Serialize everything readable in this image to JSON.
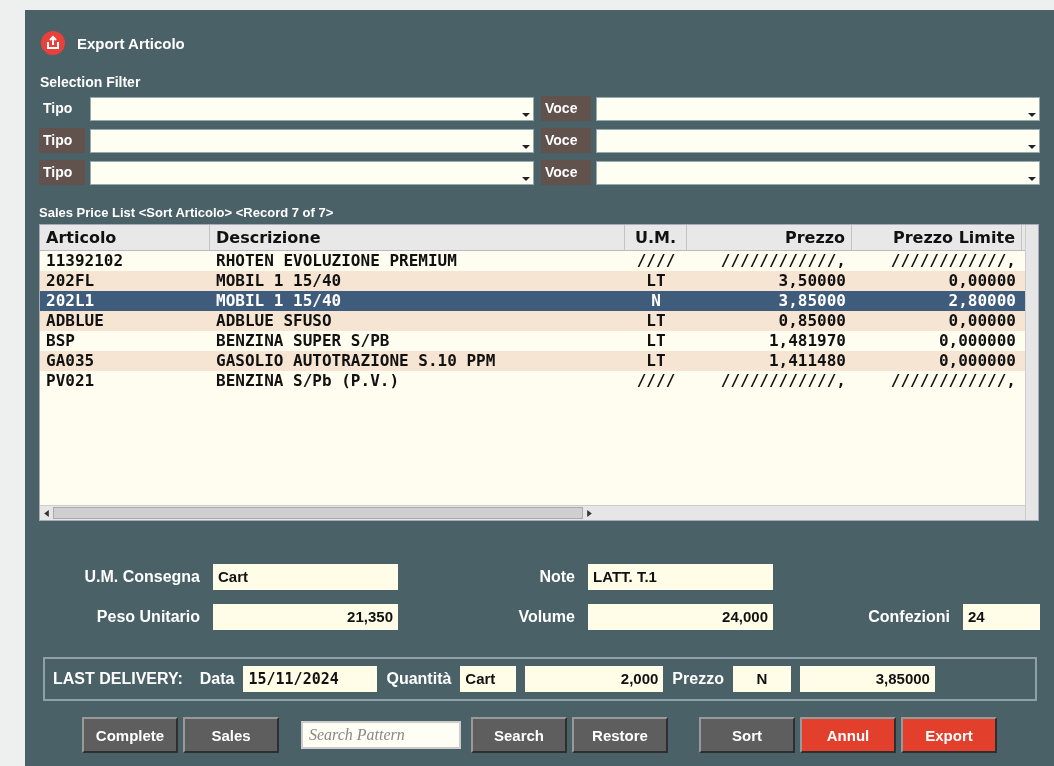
{
  "window": {
    "title": "Export Articolo"
  },
  "selection_filter": {
    "title": "Selection Filter",
    "rows": [
      {
        "tipo": {
          "label": "Tipo",
          "shaded": false
        },
        "voce": {
          "label": "Voce",
          "shaded": true
        }
      },
      {
        "tipo": {
          "label": "Tipo",
          "shaded": true
        },
        "voce": {
          "label": "Voce",
          "shaded": true
        }
      },
      {
        "tipo": {
          "label": "Tipo",
          "shaded": true
        },
        "voce": {
          "label": "Voce",
          "shaded": true
        }
      }
    ]
  },
  "table": {
    "caption": "Sales Price List <Sort Articolo> <Record 7 of 7>",
    "columns": [
      "Articolo",
      "Descrizione",
      "U.M.",
      "Prezzo",
      "Prezzo Limite"
    ],
    "rows": [
      {
        "selected": false,
        "cells": [
          "11392102",
          "RHOTEN EVOLUZIONE PREMIUM",
          "////",
          "////////////,",
          "////////////,"
        ]
      },
      {
        "selected": false,
        "cells": [
          "202FL",
          "MOBIL 1 15/40",
          "LT",
          "3,50000",
          "0,00000"
        ]
      },
      {
        "selected": true,
        "cells": [
          "202L1",
          "MOBIL 1 15/40",
          "N",
          "3,85000",
          "2,80000"
        ]
      },
      {
        "selected": false,
        "cells": [
          "ADBLUE",
          "ADBLUE SFUSO",
          "LT",
          "0,85000",
          "0,00000"
        ]
      },
      {
        "selected": false,
        "cells": [
          "BSP",
          "BENZINA SUPER S/PB",
          "LT",
          "1,481970",
          "0,000000"
        ]
      },
      {
        "selected": false,
        "cells": [
          "GA035",
          "GASOLIO AUTOTRAZIONE S.10 PPM",
          "LT",
          "1,411480",
          "0,000000"
        ]
      },
      {
        "selected": false,
        "cells": [
          "PV021",
          "BENZINA S/Pb (P.V.)",
          "////",
          "////////////,",
          "////////////,"
        ]
      }
    ]
  },
  "details": {
    "um_consegna": {
      "label": "U.M. Consegna",
      "value": "Cart"
    },
    "note": {
      "label": "Note",
      "value": "LATT. T.1"
    },
    "peso_unitario": {
      "label": "Peso Unitario",
      "value": "21,350"
    },
    "volume": {
      "label": "Volume",
      "value": "24,000"
    },
    "confezioni": {
      "label": "Confezioni",
      "value": "24"
    }
  },
  "last_delivery": {
    "title": "LAST DELIVERY:",
    "data_label": "Data",
    "data": "15/11/2024",
    "quantita_label": "Quantità",
    "quantita_um": "Cart",
    "quantita": "2,000",
    "prezzo_label": "Prezzo",
    "prezzo_um": "N",
    "prezzo": "3,85000"
  },
  "buttons": [
    {
      "kind": "button",
      "label": "Complete",
      "color": "#5e5e5e"
    },
    {
      "kind": "button",
      "label": "Sales",
      "color": "#5e5e5e"
    },
    {
      "kind": "field",
      "placeholder": "Search Pattern"
    },
    {
      "kind": "button",
      "label": "Search",
      "color": "#5e5e5e"
    },
    {
      "kind": "button",
      "label": "Restore",
      "color": "#5e5e5e"
    },
    {
      "kind": "spacer"
    },
    {
      "kind": "button",
      "label": "Sort",
      "color": "#5e5e5e"
    },
    {
      "kind": "button",
      "label": "Annul",
      "color": "#e2402c"
    },
    {
      "kind": "button",
      "label": "Export",
      "color": "#e2402c"
    }
  ]
}
